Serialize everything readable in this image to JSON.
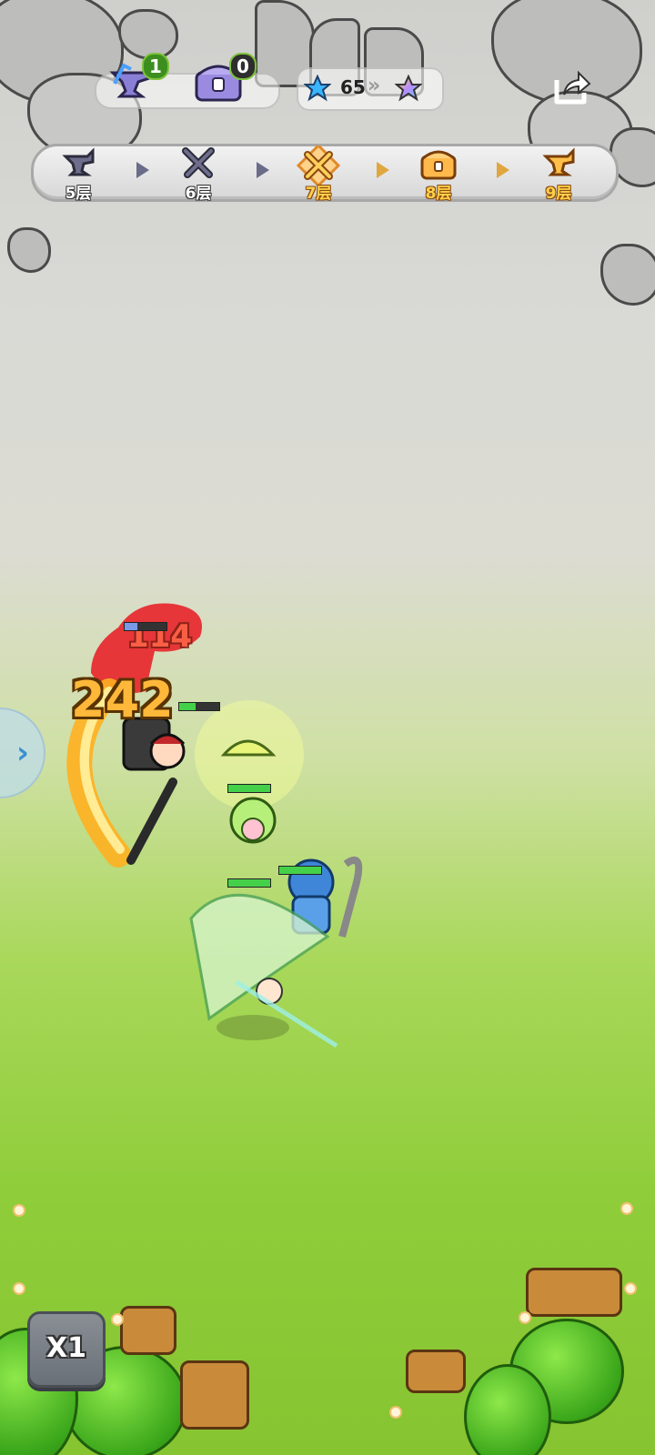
{
  "resources": {
    "anvil": {
      "icon": "anvil-icon",
      "count": "1"
    },
    "chest": {
      "icon": "treasure-chest-icon",
      "count": "0"
    },
    "stars": {
      "icon": "star-icon",
      "count": "65",
      "next_icon": "rainbow-star-icon"
    },
    "share_icon": "share-icon"
  },
  "floors": [
    {
      "label": "5层",
      "icon": "anvil-icon",
      "state": "done"
    },
    {
      "label": "6层",
      "icon": "crossed-swords-icon",
      "state": "done"
    },
    {
      "label": "7层",
      "icon": "crossed-swords-icon",
      "state": "current"
    },
    {
      "label": "8层",
      "icon": "treasure-chest-icon",
      "state": "future"
    },
    {
      "label": "9层",
      "icon": "anvil-icon",
      "state": "future"
    }
  ],
  "battle": {
    "damage_big": "242",
    "damage_small": "114"
  },
  "controls": {
    "speed_label": "X1",
    "side_tab_icon": "chevron-right-icon"
  },
  "colors": {
    "hp_green": "#45d04a",
    "damage_orange": "#ffb83a",
    "damage_red": "#ff6a4a",
    "floor_future": "#ffd24a"
  }
}
